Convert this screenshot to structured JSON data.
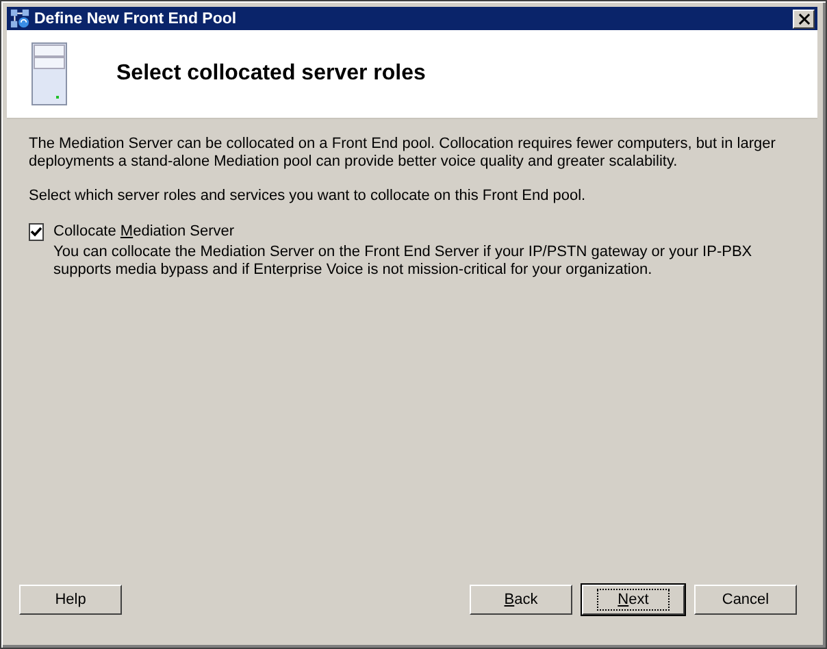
{
  "window": {
    "title": "Define New Front End Pool"
  },
  "header": {
    "title": "Select collocated server roles"
  },
  "intro": "The Mediation Server can be collocated on a Front End pool. Collocation requires fewer computers, but in larger deployments a stand-alone Mediation pool can provide better voice quality and greater scalability.",
  "instruction": "Select which server roles and services you want to collocate on this Front End pool.",
  "options": [
    {
      "label": {
        "before": "Collocate ",
        "key": "M",
        "after": "ediation Server"
      },
      "checked": true,
      "description": "You can collocate the Mediation Server on the Front End Server if your IP/PSTN gateway or your IP-PBX supports media bypass and if Enterprise Voice is not mission-critical for your organization."
    }
  ],
  "left_buttons": [
    {
      "label": {
        "before": "Help"
      },
      "default": false
    }
  ],
  "right_buttons": [
    {
      "label": {
        "key": "B",
        "after": "ack"
      },
      "default": false
    },
    {
      "label": {
        "key": "N",
        "after": "ext"
      },
      "default": true
    },
    {
      "label": {
        "before": "Cancel"
      },
      "default": false
    }
  ]
}
